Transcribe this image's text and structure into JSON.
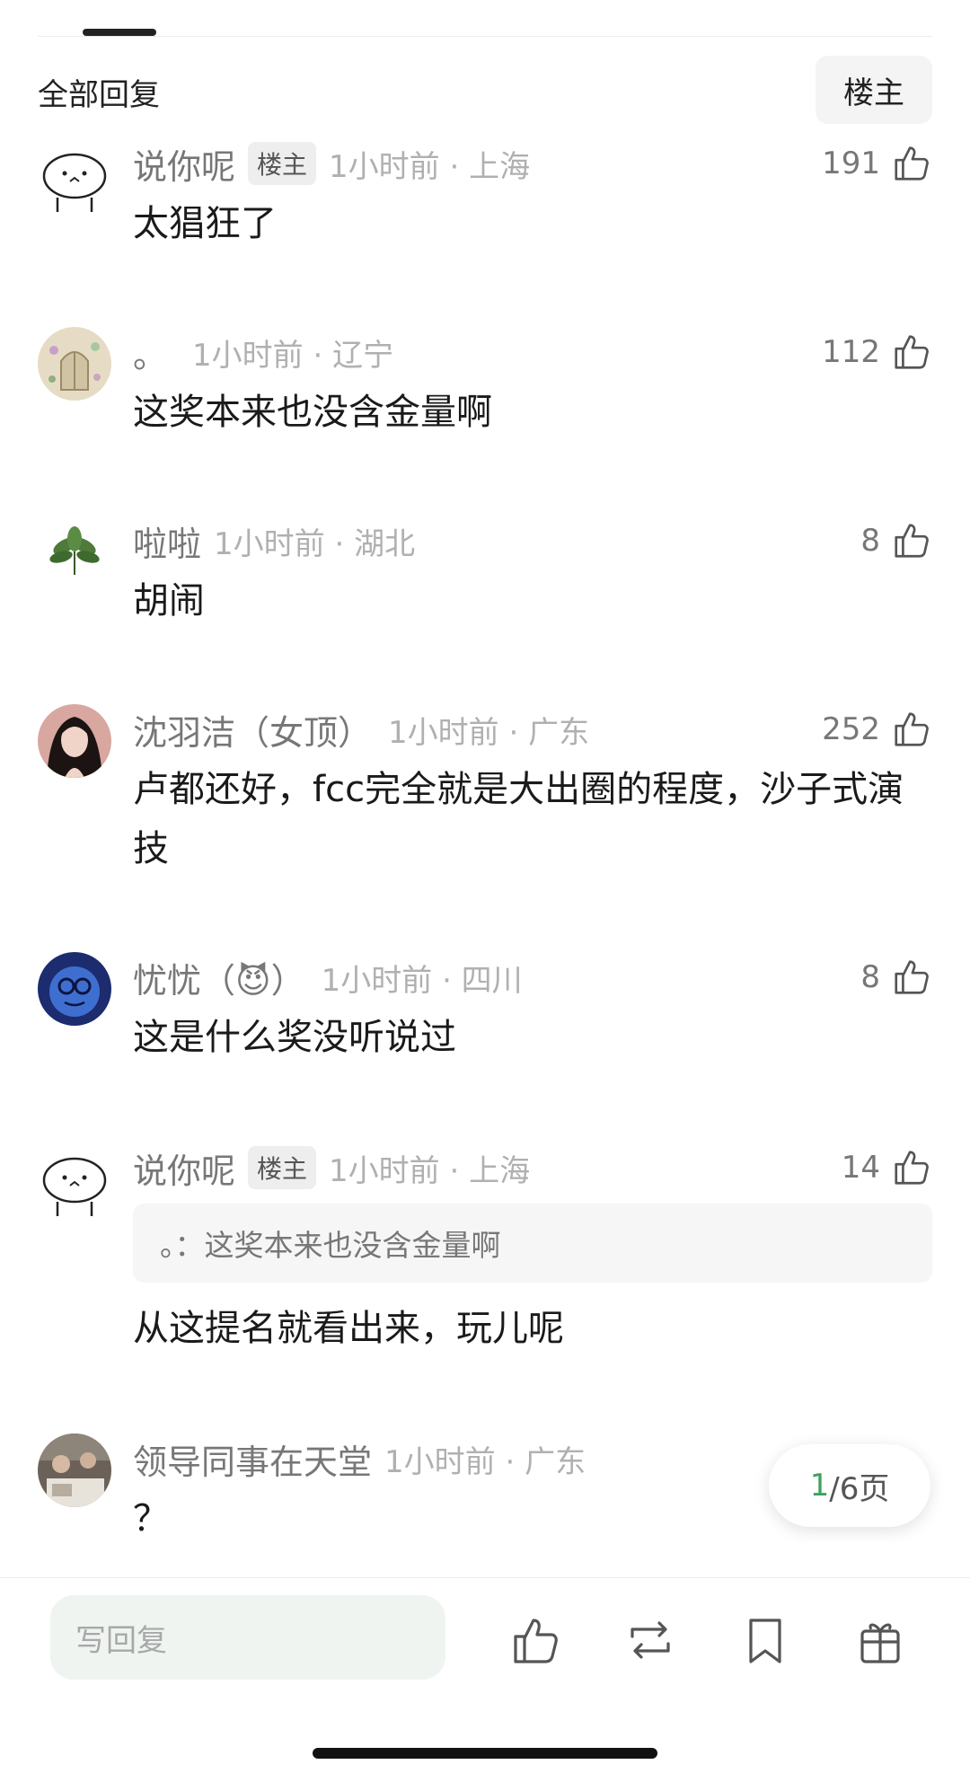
{
  "header": {
    "title": "全部回复",
    "op_filter_label": "楼主"
  },
  "comments": [
    {
      "username": "说你呢",
      "badge": "楼主",
      "time_location": "1小时前 · 上海",
      "likes": "191",
      "text": "太猖狂了"
    },
    {
      "username": "。",
      "time_location": "1小时前 · 辽宁",
      "likes": "112",
      "text": "这奖本来也没含金量啊"
    },
    {
      "username": "啦啦",
      "time_location": "1小时前 · 湖北",
      "likes": "8",
      "text": "胡闹"
    },
    {
      "username": "沈羽洁（女顶）",
      "time_location": "1小时前 · 广东",
      "likes": "252",
      "text": "卢都还好，fcc完全就是大出圈的程度，沙子式演技"
    },
    {
      "username": "忧忧（😈）",
      "time_location": "1小时前 · 四川",
      "likes": "8",
      "text": "这是什么奖没听说过"
    },
    {
      "username": "说你呢",
      "badge": "楼主",
      "time_location": "1小时前 · 上海",
      "likes": "14",
      "quote": "。：这奖本来也没含金量啊",
      "text": "从这提名就看出来，玩儿呢"
    },
    {
      "username": "领导同事在天堂",
      "time_location": "1小时前 · 广东",
      "text": "？"
    }
  ],
  "pagination": {
    "current": "1",
    "total_label": "/6页"
  },
  "bottom_bar": {
    "reply_placeholder": "写回复"
  },
  "colors": {
    "accent_green": "#3aa35c",
    "meta_gray": "#b0b0b0",
    "name_gray": "#777777"
  }
}
